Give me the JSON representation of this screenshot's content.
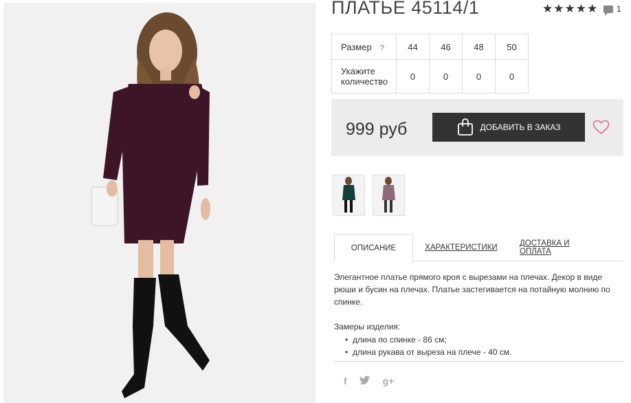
{
  "product": {
    "title": "ПЛАТЬЕ 45114/1",
    "rating_stars": "★★★★★",
    "rating_value": 5,
    "comments_count": "1"
  },
  "sizes": {
    "size_label": "Размер",
    "help": "?",
    "qty_label": "Укажите количество",
    "options": [
      "44",
      "46",
      "48",
      "50"
    ],
    "quantities": [
      "0",
      "0",
      "0",
      "0"
    ]
  },
  "purchase": {
    "price": "999 руб",
    "add_label": "ДОБАВИТЬ В ЗАКАЗ"
  },
  "tabs": [
    "ОПИСАНИЕ",
    "ХАРАКТЕРИСТИКИ",
    "ДОСТАВКА И ОПЛАТА"
  ],
  "description": {
    "text": "Элегантное платье прямого кроя с вырезами на плечах. Декор в виде рюши и бусин на плечах. Платье застегивается на потайную молнию по спинке.",
    "measures_title": "Замеры изделия:",
    "measures": [
      "длина по спинке - 86 см;",
      "длина рукава от выреза на плече - 40 см."
    ]
  },
  "social": [
    "f",
    "t",
    "g+"
  ],
  "colors": {
    "dress": "#3d1527",
    "button": "#333333",
    "heart": "#e07a8f",
    "price_bg": "#ececec"
  }
}
